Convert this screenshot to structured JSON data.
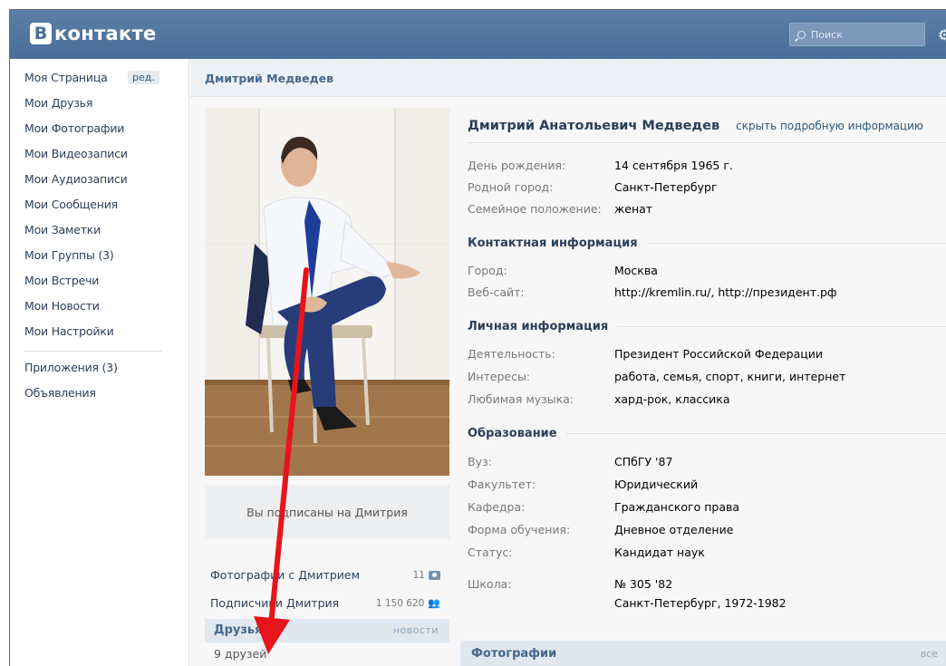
{
  "header": {
    "logo_letter": "В",
    "logo_text": "контакте",
    "search_placeholder": "Поиск",
    "settings_icon": "gear-icon"
  },
  "sidebar": {
    "items": [
      "Моя Страница",
      "Мои Друзья",
      "Мои Фотографии",
      "Мои Видеозаписи",
      "Мои Аудиозаписи",
      "Мои Сообщения",
      "Мои Заметки",
      "Мои Группы (3)",
      "Мои Встречи",
      "Мои Новости",
      "Мои Настройки"
    ],
    "edit_label": "ред.",
    "extra_items": [
      "Приложения (3)",
      "Объявления"
    ]
  },
  "breadcrumb": "Дмитрий Медведев",
  "left_column": {
    "subscribed_text": "Вы подписаны на Дмитрия",
    "stats": [
      {
        "label": "Фотографии с Дмитрием",
        "value": "11",
        "icon": "camera-icon"
      },
      {
        "label": "Подписчики Дмитрия",
        "value": "1 150 620",
        "icon": "people-icon"
      }
    ],
    "friends": {
      "title": "Друзья",
      "news_link": "новости",
      "count_text": "9 друзей"
    }
  },
  "profile": {
    "full_name": "Дмитрий Анатольевич Медведев",
    "hide_link": "скрыть подробную информацию",
    "basic": [
      {
        "label": "День рождения:",
        "value": "14 сентября 1965 г."
      },
      {
        "label": "Родной город:",
        "value": "Санкт-Петербург"
      },
      {
        "label": "Семейное положение:",
        "value": "женат"
      }
    ],
    "contact_title": "Контактная информация",
    "contact": [
      {
        "label": "Город:",
        "value": "Москва"
      },
      {
        "label": "Веб-сайт:",
        "value": "http://kremlin.ru/, http://президент.рф"
      }
    ],
    "personal_title": "Личная информация",
    "personal": [
      {
        "label": "Деятельность:",
        "value": "Президент Российской Федерации"
      },
      {
        "label": "Интересы:",
        "value": "работа, семья, спорт, книги, интернет"
      },
      {
        "label": "Любимая музыка:",
        "value": "хард-рок, классика"
      }
    ],
    "education_title": "Образование",
    "education": [
      {
        "label": "Вуз:",
        "value": "СПбГУ '87"
      },
      {
        "label": "Факультет:",
        "value": "Юридический"
      },
      {
        "label": "Кафедра:",
        "value": "Гражданского права"
      },
      {
        "label": "Форма обучения:",
        "value": "Дневное отделение"
      },
      {
        "label": "Статус:",
        "value": "Кандидат наук"
      }
    ],
    "school": {
      "label": "Школа:",
      "value": "№ 305 '82",
      "value2": "Санкт-Петербург, 1972-1982"
    }
  },
  "photos_section": {
    "title": "Фотографии",
    "all_link": "все"
  },
  "colors": {
    "header": "#4a6e98",
    "link": "#2b587a",
    "annotation_arrow": "#e8141b"
  }
}
